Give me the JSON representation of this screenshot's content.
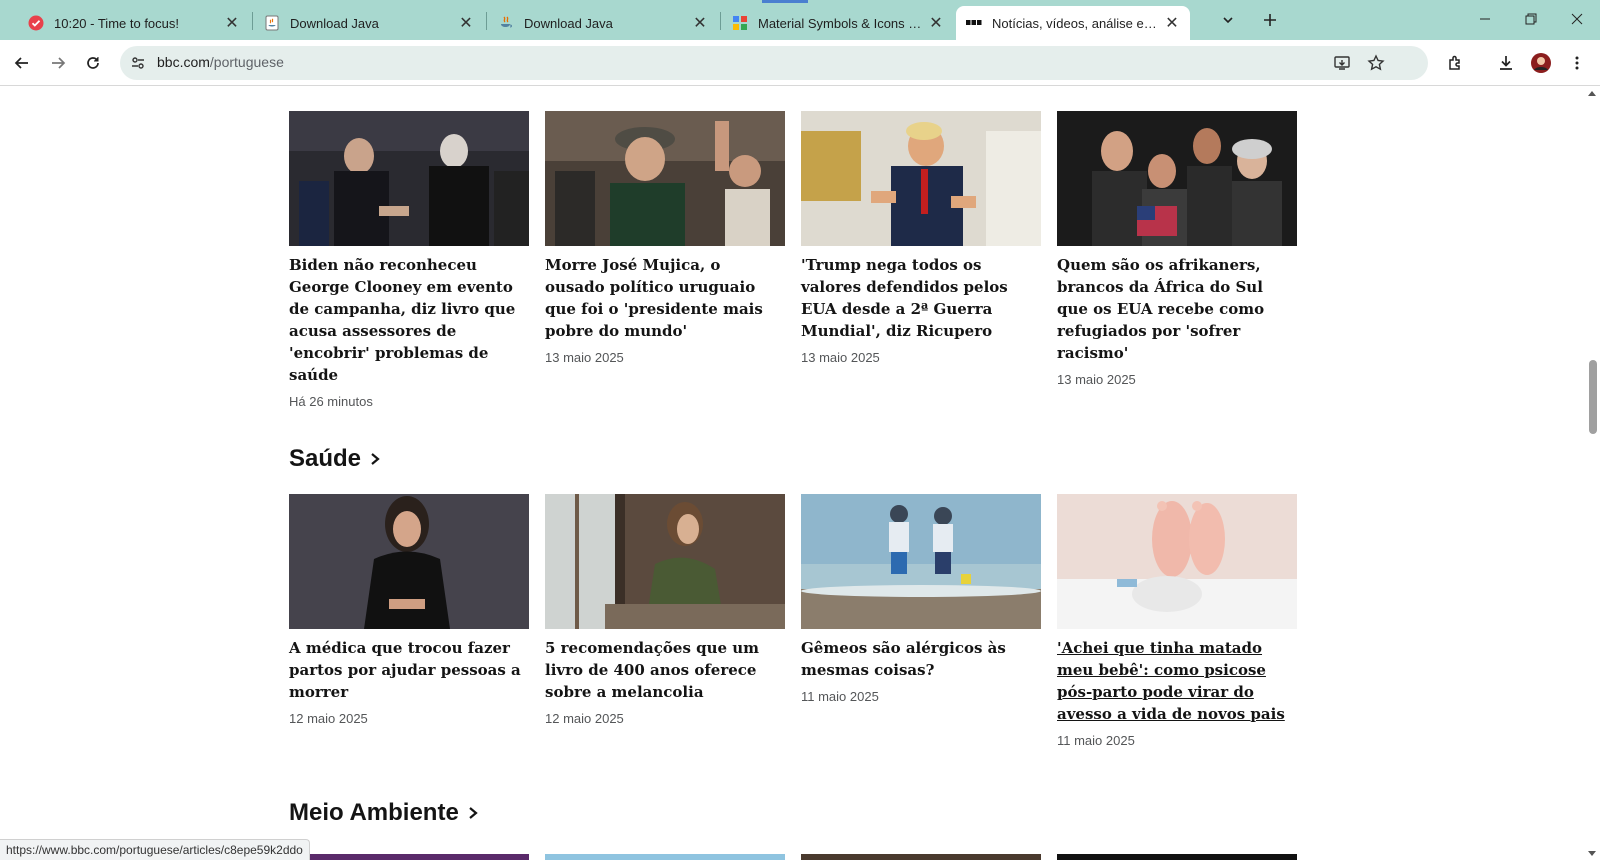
{
  "browser": {
    "tabs": [
      {
        "title": "10:20 - Time to focus!",
        "icon": "pomodoro-check-icon"
      },
      {
        "title": "Download Java",
        "icon": "java-doc-icon"
      },
      {
        "title": "Download Java",
        "icon": "java-cup-icon"
      },
      {
        "title": "Material Symbols & Icons - Goo",
        "icon": "material-icons-icon"
      },
      {
        "title": "Notícias, vídeos, análise e conte",
        "icon": "bbc-icon",
        "active": true
      }
    ],
    "url_domain": "bbc.com",
    "url_path": "/portuguese",
    "status_url": "https://www.bbc.com/portuguese/articles/c8epe59k2ddo"
  },
  "sections": {
    "top_row": [
      {
        "headline": "Biden não reconheceu George Clooney em evento de campanha, diz livro que acusa assessores de 'encobrir' problemas de saúde",
        "date": "Há 26 minutos",
        "image": "biden-clooney-photo"
      },
      {
        "headline": "Morre José Mujica, o ousado político uruguaio que foi o 'presidente mais pobre do mundo'",
        "date": "13 maio 2025",
        "image": "mujica-photo"
      },
      {
        "headline": "'Trump nega todos os valores defendidos pelos EUA desde a 2ª Guerra Mundial', diz Ricupero",
        "date": "13 maio 2025",
        "image": "trump-photo"
      },
      {
        "headline": "Quem são os afrikaners, brancos da África do Sul que os EUA recebe como refugiados por 'sofrer racismo'",
        "date": "13 maio 2025",
        "image": "afrikaners-photo"
      }
    ],
    "saude": {
      "title": "Saúde",
      "items": [
        {
          "headline": "A médica que trocou fazer partos por ajudar pessoas a morrer",
          "date": "12 maio 2025",
          "image": "doctor-portrait-photo"
        },
        {
          "headline": "5 recomendações que um livro de 400 anos oferece sobre a melancolia",
          "date": "12 maio 2025",
          "image": "woman-window-photo"
        },
        {
          "headline": "Gêmeos são alérgicos às mesmas coisas?",
          "date": "11 maio 2025",
          "image": "twins-beach-photo"
        },
        {
          "headline": "'Achei que tinha matado meu bebê': como psicose pós-parto pode virar do avesso a vida de novos pais",
          "date": "11 maio 2025",
          "image": "baby-feet-photo"
        }
      ]
    },
    "meio_ambiente": {
      "title": "Meio Ambiente"
    }
  }
}
